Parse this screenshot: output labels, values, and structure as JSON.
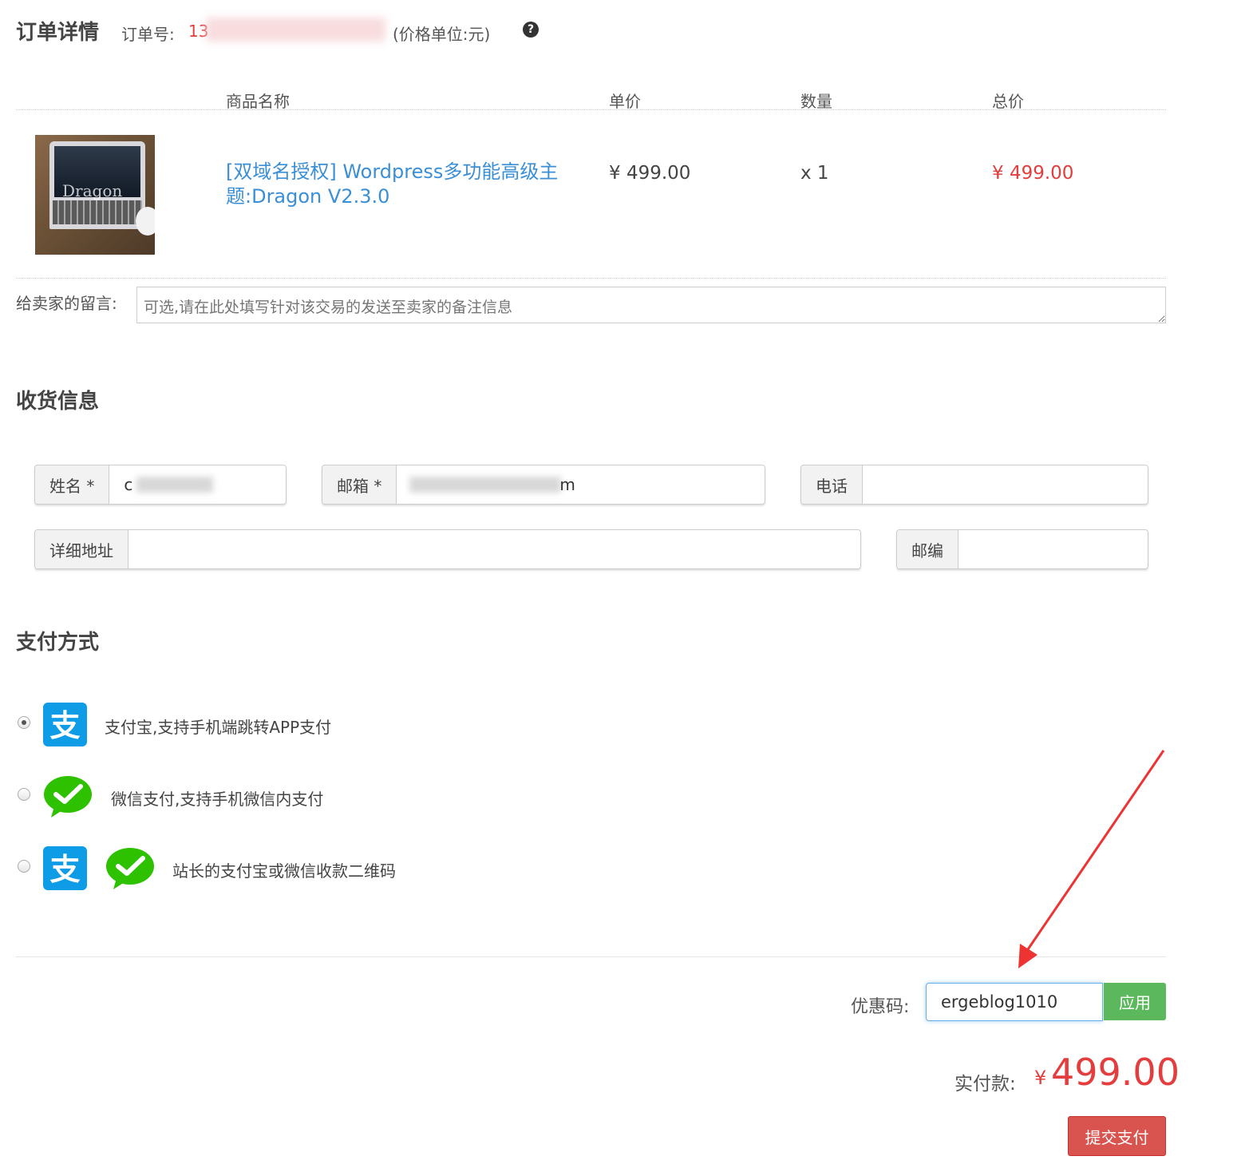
{
  "header": {
    "title": "订单详情",
    "order_label": "订单号:",
    "order_prefix": "13",
    "price_unit": "(价格单位:元)",
    "help_icon": "question-circle-icon"
  },
  "table": {
    "columns": [
      "商品名称",
      "单价",
      "数量",
      "总价"
    ],
    "item": {
      "thumb_text": "Dragon",
      "name_line1": "[双域名授权] Wordpress多功能高级主",
      "name_line2": "题:Dragon V2.3.0",
      "unit_price": "¥ 499.00",
      "quantity": "x 1",
      "total": "¥ 499.00"
    }
  },
  "message": {
    "label": "给卖家的留言:",
    "placeholder": "可选,请在此处填写针对该交易的发送至卖家的备注信息"
  },
  "shipping": {
    "title": "收货信息",
    "name_label": "姓名 *",
    "name_value": "c",
    "email_label": "邮箱 *",
    "email_value_end": "m",
    "phone_label": "电话",
    "address_label": "详细地址",
    "zip_label": "邮编"
  },
  "payment": {
    "title": "支付方式",
    "options": [
      {
        "label": "支付宝,支持手机端跳转APP支付",
        "selected": true,
        "icons": [
          "alipay-icon"
        ]
      },
      {
        "label": "微信支付,支持手机微信内支付",
        "selected": false,
        "icons": [
          "wechat-icon"
        ]
      },
      {
        "label": "站长的支付宝或微信收款二维码",
        "selected": false,
        "icons": [
          "alipay-icon",
          "wechat-icon"
        ]
      }
    ]
  },
  "coupon": {
    "label": "优惠码:",
    "value": "ergeblog1010",
    "apply_label": "应用"
  },
  "summary": {
    "label": "实付款:",
    "currency": "¥",
    "amount": "499.00",
    "submit_label": "提交支付"
  },
  "colors": {
    "accent_red": "#e33d3d",
    "link_blue": "#3a8fd6",
    "apply_green": "#5cb85c",
    "submit_red": "#d9534f",
    "alipay_blue": "#0e9ce7",
    "wechat_green": "#2dc100"
  }
}
